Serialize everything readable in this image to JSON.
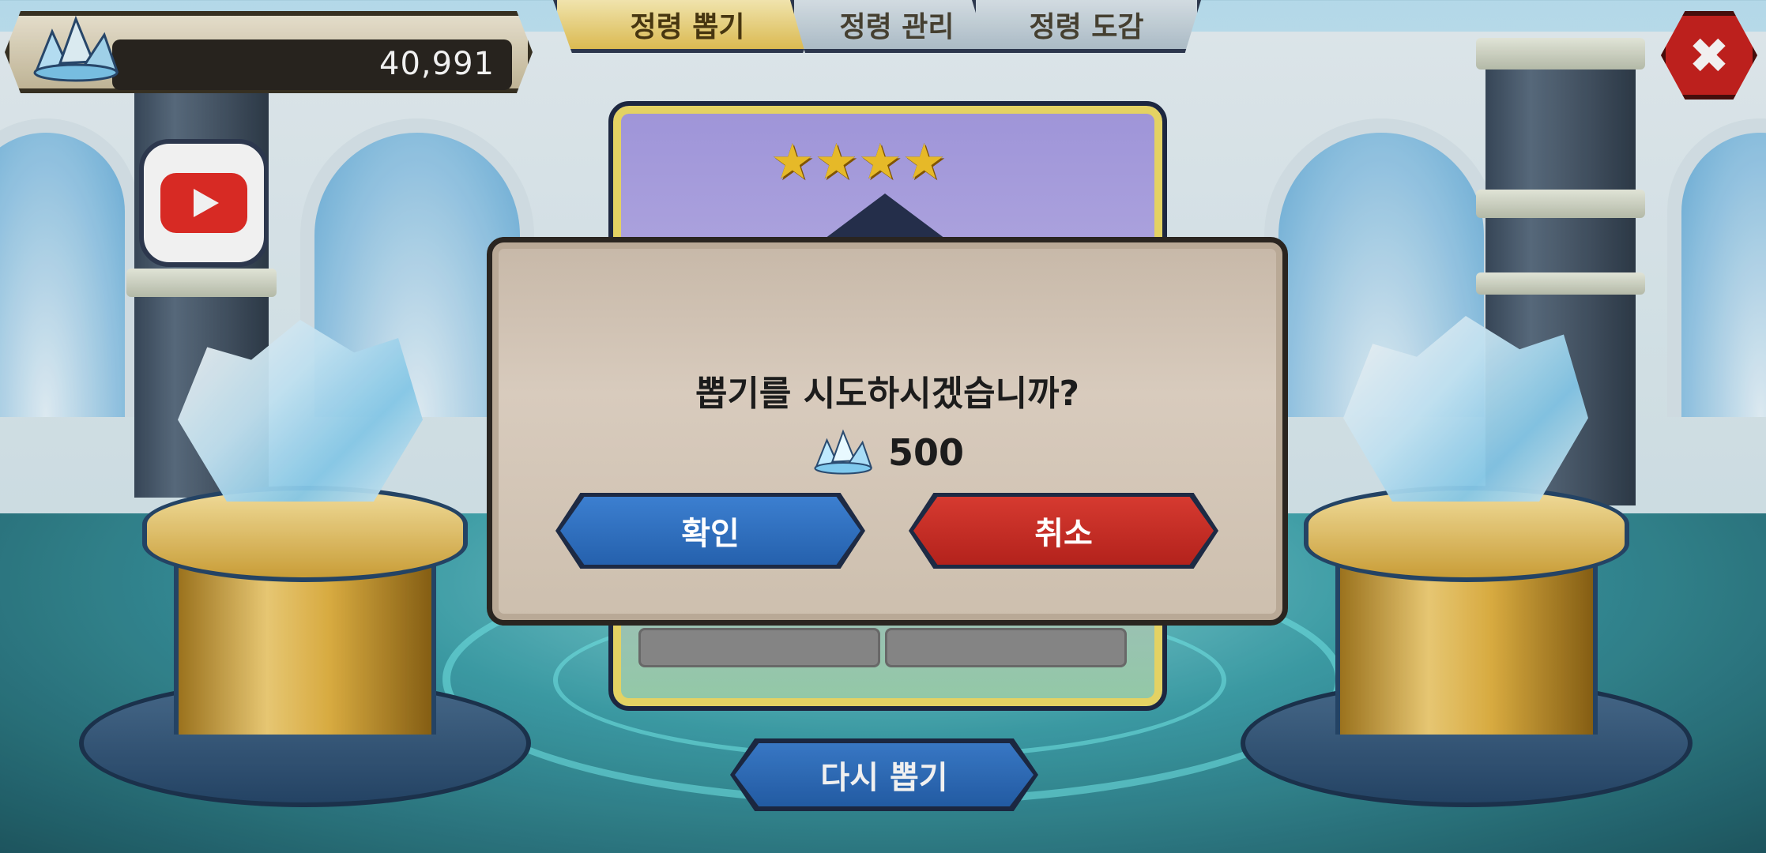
{
  "hud": {
    "currency_icon": "crystal-icon",
    "currency_value": "40,991"
  },
  "tabs": [
    {
      "label": "정령 뽑기",
      "active": true
    },
    {
      "label": "정령 관리",
      "active": false
    },
    {
      "label": "정령 도감",
      "active": false
    }
  ],
  "close_icon": "close-icon",
  "youtube_icon": "youtube-icon",
  "card": {
    "stars": "★★★★",
    "star_count": 4
  },
  "dialog": {
    "message": "뽑기를 시도하시겠습니까?",
    "cost_icon": "crystal-icon",
    "cost_value": "500",
    "confirm_label": "확인",
    "cancel_label": "취소"
  },
  "retry": {
    "label": "다시 뽑기"
  },
  "colors": {
    "confirm": "#2561ad",
    "cancel": "#b3221c",
    "star": "#f5c52b",
    "close": "#c8231f"
  }
}
